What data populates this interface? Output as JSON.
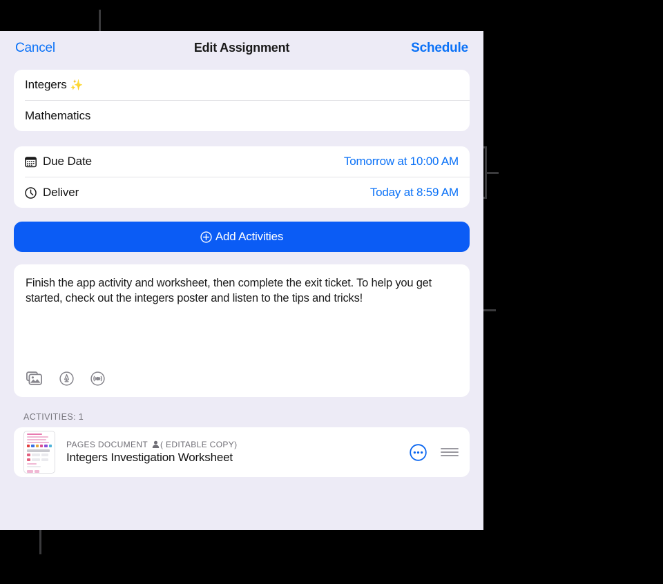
{
  "navbar": {
    "cancel_label": "Cancel",
    "title": "Edit Assignment",
    "schedule_label": "Schedule"
  },
  "fields": {
    "assignment_title": "Integers",
    "assignment_title_sparkle": "✨",
    "subject": "Mathematics"
  },
  "dates": {
    "due_date_label": "Due Date",
    "due_date_value": "Tomorrow at 10:00 AM",
    "deliver_label": "Deliver",
    "deliver_value": "Today at 8:59 AM",
    "due_date_icon": "calendar-icon",
    "deliver_icon": "clock-icon"
  },
  "add_activities": {
    "label": "Add Activities",
    "icon": "plus-circle-icon",
    "color": "#0b5cf5"
  },
  "description": {
    "text": "Finish the app activity and worksheet, then complete the exit ticket. To help you get started, check out the integers poster and listen to the tips and tricks!",
    "tools": [
      {
        "name": "photo-library-icon",
        "title": "Add photo or video"
      },
      {
        "name": "markup-pen-icon",
        "title": "Markup"
      },
      {
        "name": "audio-record-icon",
        "title": "Record audio"
      }
    ]
  },
  "activities": {
    "section_label": "ACTIVITIES: 1",
    "items": [
      {
        "kind": "PAGES DOCUMENT",
        "copy_badge": "( EDITABLE COPY)",
        "copy_badge_icon": "person-icon",
        "title": "Integers Investigation Worksheet",
        "more_icon": "more-circle-icon",
        "reorder_icon": "reorder-handle-icon"
      }
    ]
  },
  "theme": {
    "accent_blue": "#0a71f7",
    "button_blue": "#0b5cf5",
    "panel_background": "#edebf6",
    "card_background": "#ffffff",
    "backdrop": "#000000"
  }
}
